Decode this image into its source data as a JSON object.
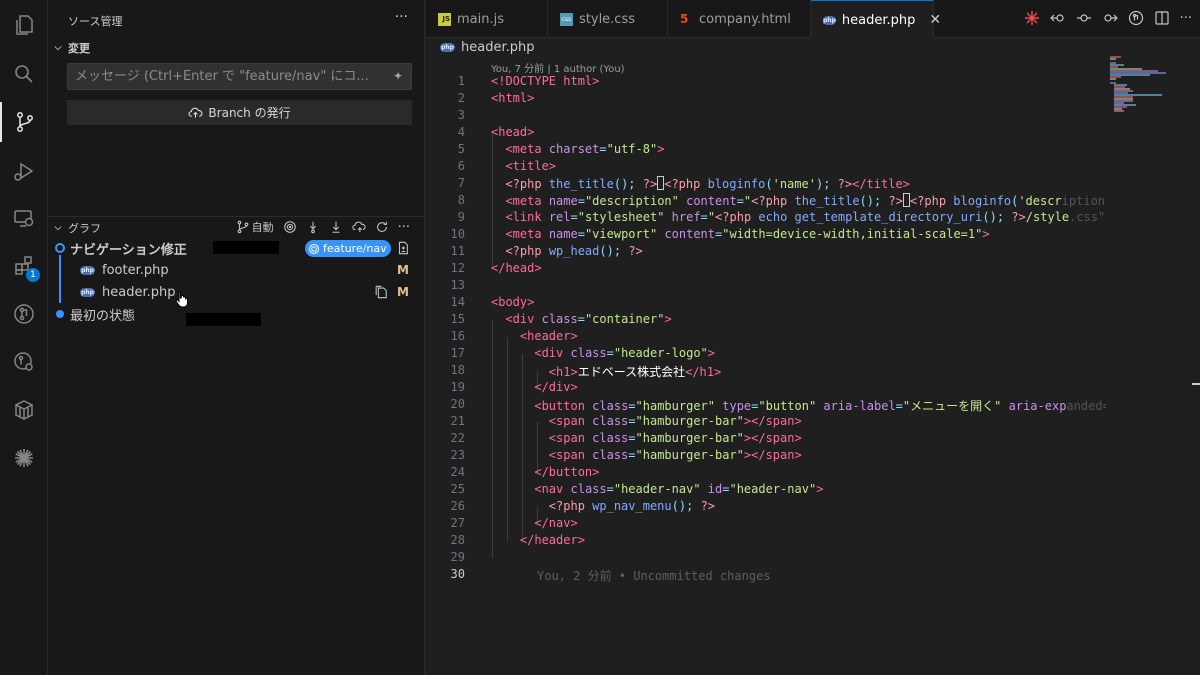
{
  "activity_bar": {
    "items": [
      {
        "icon": "files-icon"
      },
      {
        "icon": "search-icon"
      },
      {
        "icon": "source-control-icon"
      },
      {
        "icon": "run-debug-icon"
      },
      {
        "icon": "remote-explorer-icon"
      },
      {
        "icon": "extensions-icon",
        "badge": "1"
      },
      {
        "icon": "gitlens-icon"
      },
      {
        "icon": "gitlens-inspect-icon"
      },
      {
        "icon": "containers-icon"
      },
      {
        "icon": "copilot-icon"
      }
    ]
  },
  "sidebar": {
    "title": "ソース管理",
    "changes": {
      "header": "変更",
      "message_placeholder": "メッセージ (Ctrl+Enter で \"feature/nav\" にコ...",
      "publish_button": "Branch の発行"
    },
    "graph": {
      "header": "グラフ",
      "auto_label": "自動",
      "commits": [
        {
          "message": "ナビゲーション修正",
          "branch": "feature/nav"
        },
        {
          "message": "最初の状態"
        }
      ],
      "files": [
        {
          "name": "footer.php",
          "status": "M"
        },
        {
          "name": "header.php",
          "status": "M"
        }
      ]
    }
  },
  "tabs": [
    {
      "label": "main.js",
      "icon": "js-file-icon"
    },
    {
      "label": "style.css",
      "icon": "css-file-icon"
    },
    {
      "label": "company.html",
      "icon": "html-file-icon"
    },
    {
      "label": "header.php",
      "icon": "php-file-icon",
      "active": true
    }
  ],
  "editor": {
    "breadcrumb": "header.php",
    "blame_header": "You, 7 分前 | 1 author (You)",
    "current_line": 30,
    "inline_blame": "You, 2 分前 • Uncommitted changes",
    "line_numbers": [
      "1",
      "2",
      "3",
      "4",
      "5",
      "6",
      "7",
      "8",
      "9",
      "10",
      "11",
      "12",
      "13",
      "14",
      "15",
      "16",
      "17",
      "18",
      "19",
      "20",
      "21",
      "22",
      "23",
      "24",
      "25",
      "26",
      "27",
      "28",
      "29",
      "30"
    ],
    "code": {
      "l1_doctype": "<!DOCTYPE html>",
      "h1_text": "エドベース株式会社",
      "aria_label": "メニューを開く"
    }
  },
  "colors": {
    "accent": "#0078d4",
    "branch_pill": "#3794ff",
    "modified": "#e2c08d"
  }
}
